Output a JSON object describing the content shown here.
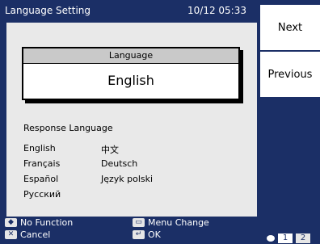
{
  "titlebar": {
    "title": "Language Setting",
    "datetime": "10/12 05:33"
  },
  "language_box": {
    "header": "Language",
    "value": "English"
  },
  "response_language": {
    "label": "Response Language",
    "options": [
      "English",
      "中文",
      "Français",
      "Deutsch",
      "Español",
      "Język polski",
      "Русский"
    ]
  },
  "footer": {
    "no_function": "No Function",
    "menu_change": "Menu Change",
    "cancel": "Cancel",
    "ok": "OK"
  },
  "side": {
    "next": "Next",
    "previous": "Previous"
  },
  "pager": {
    "pages": [
      "1",
      "2"
    ],
    "current": "1"
  },
  "colors": {
    "background": "#1b2f66",
    "panel": "#e9e9e9"
  }
}
